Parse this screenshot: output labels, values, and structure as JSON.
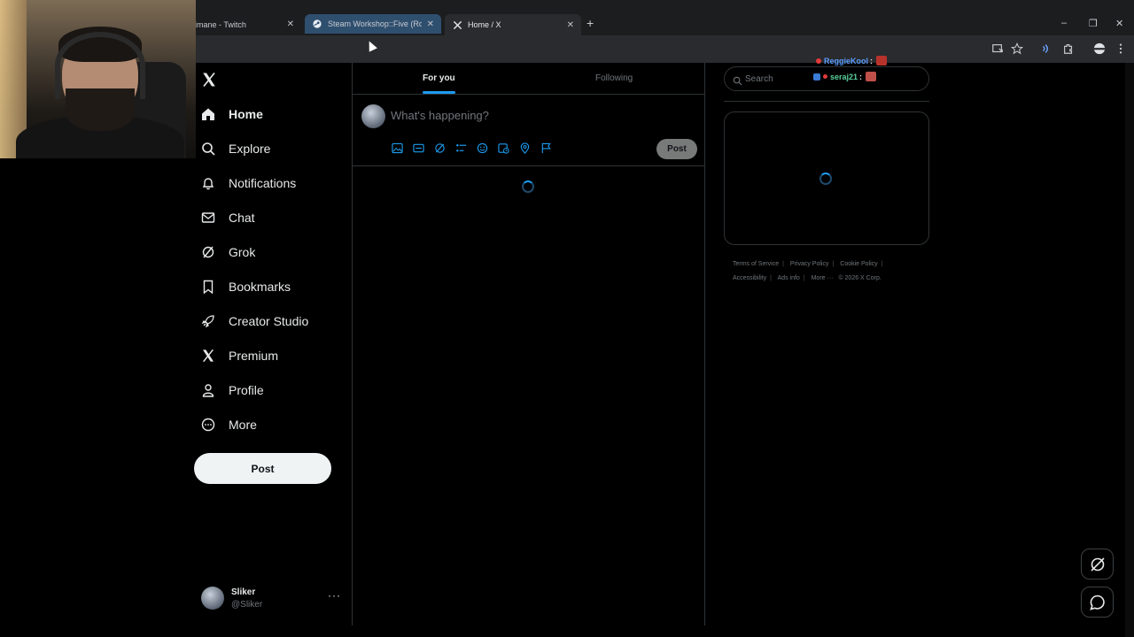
{
  "browser": {
    "tabs": [
      {
        "title": "imane - Twitch",
        "icon": "twitch-icon"
      },
      {
        "title": "Steam Workshop::Five (Rough ...",
        "icon": "steam-icon"
      },
      {
        "title": "Home / X",
        "icon": "x-logo-icon"
      }
    ],
    "new_tab": "+",
    "window_controls": [
      "–",
      "❐",
      "✕"
    ]
  },
  "x": {
    "nav": [
      {
        "label": "Home",
        "icon": "home-icon"
      },
      {
        "label": "Explore",
        "icon": "search-icon"
      },
      {
        "label": "Notifications",
        "icon": "bell-icon"
      },
      {
        "label": "Chat",
        "icon": "mail-icon"
      },
      {
        "label": "Grok",
        "icon": "grok-icon"
      },
      {
        "label": "Bookmarks",
        "icon": "bookmark-icon"
      },
      {
        "label": "Creator Studio",
        "icon": "rocket-icon"
      },
      {
        "label": "Premium",
        "icon": "x-logo-icon"
      },
      {
        "label": "Profile",
        "icon": "person-icon"
      },
      {
        "label": "More",
        "icon": "more-circle-icon"
      }
    ],
    "post_button": "Post",
    "account": {
      "name": "Sliker",
      "handle": "@Sliker",
      "more": "···"
    },
    "feed_tabs": {
      "for_you": "For you",
      "following": "Following"
    },
    "composer": {
      "placeholder": "What's happening?",
      "post_label": "Post"
    },
    "search_placeholder": "Search",
    "footer": [
      "Terms of Service",
      "Privacy Policy",
      "Cookie Policy",
      "Accessibility",
      "Ads info",
      "More ···",
      "© 2026 X Corp."
    ],
    "accent_color": "#1d9bf0"
  },
  "stream_chat": [
    {
      "user": "ReggieKool",
      "color": "#5a9cff"
    },
    {
      "user": "seraj21",
      "color": "#58d19b"
    }
  ]
}
